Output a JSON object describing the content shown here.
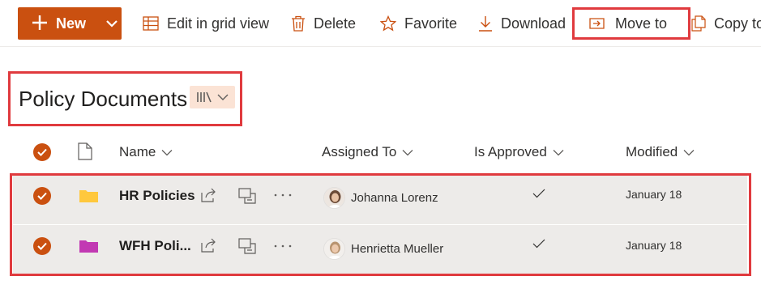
{
  "toolbar": {
    "new_label": "New",
    "edit_grid_label": "Edit in grid view",
    "delete_label": "Delete",
    "favorite_label": "Favorite",
    "download_label": "Download",
    "move_to_label": "Move to",
    "copy_to_label": "Copy to"
  },
  "library": {
    "title": "Policy Documents"
  },
  "columns": {
    "name": "Name",
    "assigned_to": "Assigned To",
    "is_approved": "Is Approved",
    "modified": "Modified"
  },
  "rows": [
    {
      "name": "HR Policies",
      "assigned_to": "Johanna Lorenz",
      "is_approved": true,
      "modified": "January 18",
      "folder_color": "#ffc83d"
    },
    {
      "name": "WFH Poli...",
      "assigned_to": "Henrietta Mueller",
      "is_approved": true,
      "modified": "January 18",
      "folder_color": "#c239b3"
    }
  ],
  "colors": {
    "accent": "#ca5010",
    "highlight": "#e03a3e",
    "selected_row": "#edebe9"
  }
}
